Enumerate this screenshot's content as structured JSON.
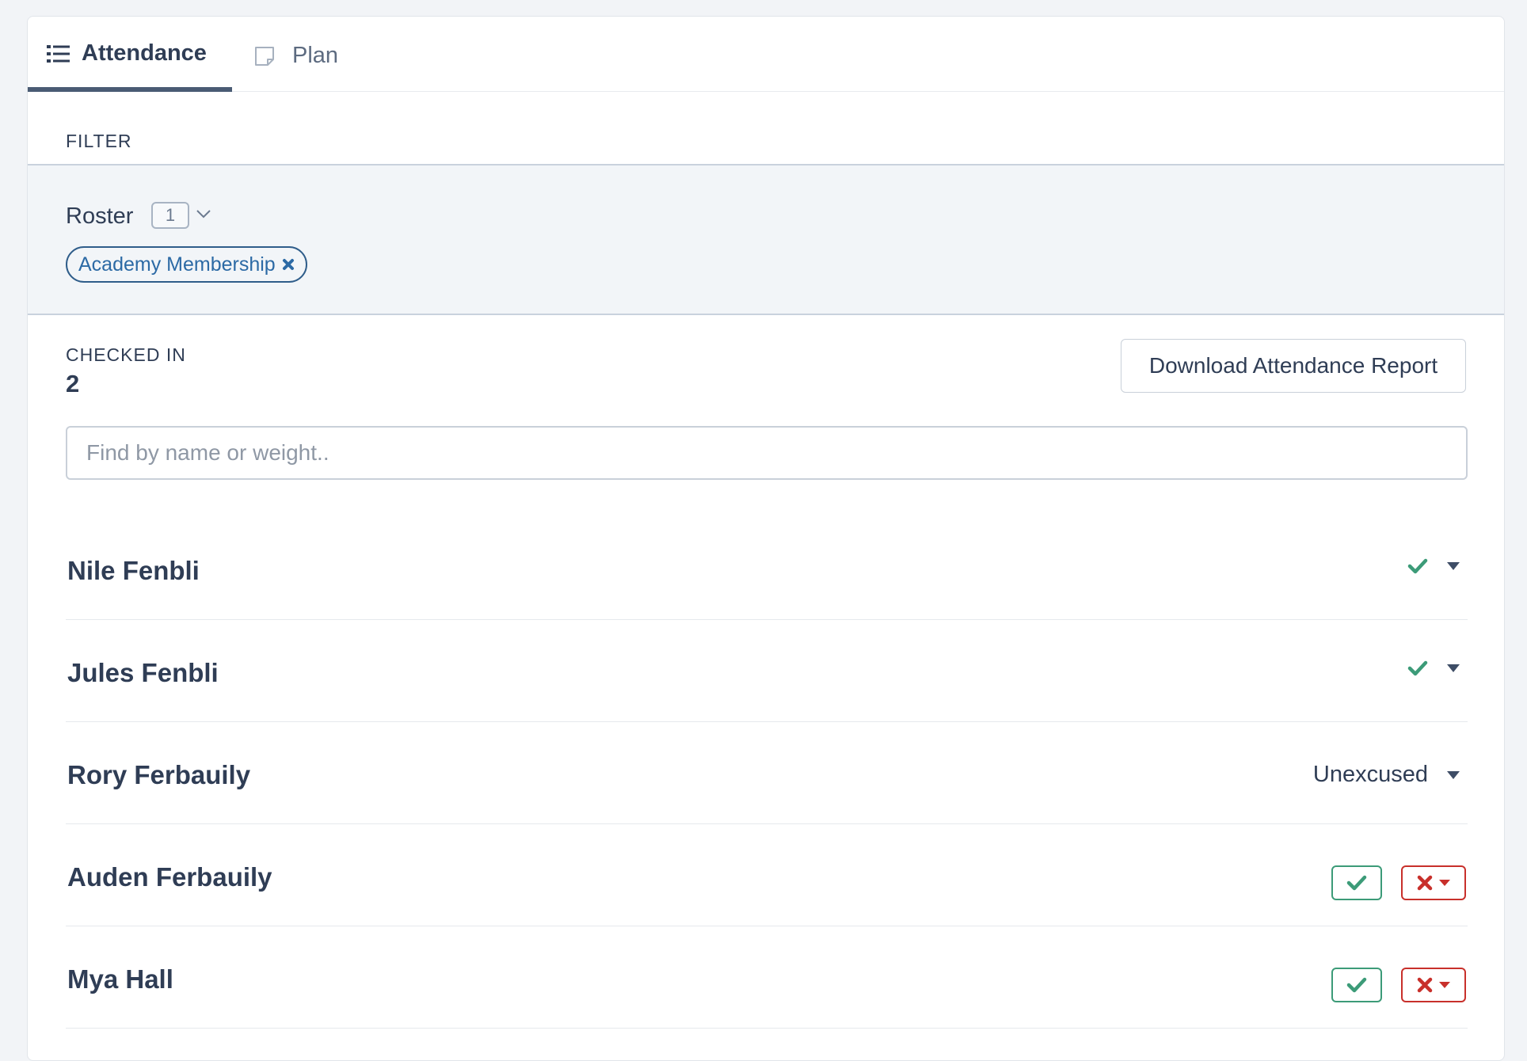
{
  "tabs": [
    {
      "label": "Attendance",
      "icon": "list-icon",
      "active": true
    },
    {
      "label": "Plan",
      "icon": "note-icon",
      "active": false
    }
  ],
  "filter": {
    "label": "FILTER",
    "roster_label": "Roster",
    "roster_count": "1",
    "chips": [
      {
        "label": "Academy Membership"
      }
    ]
  },
  "summary": {
    "checked_in_label": "CHECKED IN",
    "checked_in_value": "2",
    "download_label": "Download Attendance Report"
  },
  "search": {
    "placeholder": "Find by name or weight.."
  },
  "members": [
    {
      "name": "Nile Fenbli",
      "status": "present"
    },
    {
      "name": "Jules Fenbli",
      "status": "present"
    },
    {
      "name": "Rory Ferbauily",
      "status": "unexcused",
      "status_text": "Unexcused"
    },
    {
      "name": "Auden Ferbauily",
      "status": "unmarked"
    },
    {
      "name": "Mya Hall",
      "status": "unmarked"
    }
  ],
  "colors": {
    "text": "#2f3d55",
    "present": "#3c9b78",
    "absent": "#c8302b",
    "chip": "#2c6aa5",
    "active_tab": "#4a5b74"
  }
}
